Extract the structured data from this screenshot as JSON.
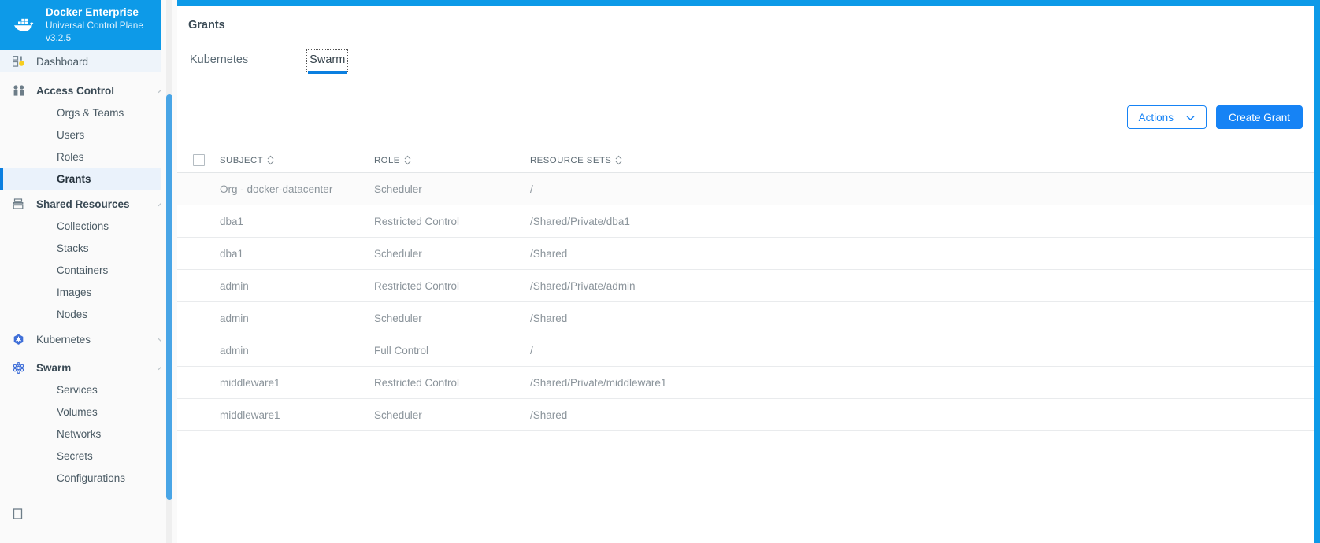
{
  "brand": {
    "logo_icon": "docker-whale-icon",
    "title": "Docker Enterprise",
    "subtitle": "Universal Control Plane v3.2.5",
    "bg_color": "#0d9ae8"
  },
  "sidebar": {
    "dashboard": {
      "label": "Dashboard",
      "icon": "dashboard-icon"
    },
    "groups": [
      {
        "label": "Access Control",
        "icon": "users-icon",
        "expanded": true,
        "chevron": "chevron-up-icon",
        "items": [
          {
            "label": "Orgs & Teams",
            "active": false
          },
          {
            "label": "Users",
            "active": false
          },
          {
            "label": "Roles",
            "active": false
          },
          {
            "label": "Grants",
            "active": true
          }
        ]
      },
      {
        "label": "Shared Resources",
        "icon": "layers-icon",
        "expanded": true,
        "chevron": "chevron-up-icon",
        "items": [
          {
            "label": "Collections",
            "active": false
          },
          {
            "label": "Stacks",
            "active": false
          },
          {
            "label": "Containers",
            "active": false
          },
          {
            "label": "Images",
            "active": false
          },
          {
            "label": "Nodes",
            "active": false
          }
        ]
      },
      {
        "label": "Kubernetes",
        "icon": "kubernetes-icon",
        "expanded": false,
        "chevron": "chevron-down-icon",
        "items": []
      },
      {
        "label": "Swarm",
        "icon": "swarm-icon",
        "expanded": true,
        "chevron": "chevron-up-icon",
        "items": [
          {
            "label": "Services",
            "active": false
          },
          {
            "label": "Volumes",
            "active": false
          },
          {
            "label": "Networks",
            "active": false
          },
          {
            "label": "Secrets",
            "active": false
          },
          {
            "label": "Configurations",
            "active": false
          }
        ]
      }
    ],
    "scrollbar": {
      "thumb_color": "#49a5e6",
      "track_color": "#efefef"
    }
  },
  "main": {
    "page_title": "Grants",
    "tabs": [
      {
        "label": "Kubernetes",
        "active": false
      },
      {
        "label": "Swarm",
        "active": true
      }
    ],
    "toolbar": {
      "actions_label": "Actions",
      "actions_chevron": "chevron-down-icon",
      "create_label": "Create Grant",
      "primary_color": "#1683f5"
    },
    "table": {
      "select_all_checkbox": false,
      "columns": [
        {
          "label": "SUBJECT",
          "sortable": true
        },
        {
          "label": "ROLE",
          "sortable": true
        },
        {
          "label": "RESOURCE SETS",
          "sortable": true
        }
      ],
      "rows": [
        {
          "subject": "Org - docker-datacenter",
          "role": "Scheduler",
          "resource_sets": "/"
        },
        {
          "subject": "dba1",
          "role": "Restricted Control",
          "resource_sets": "/Shared/Private/dba1"
        },
        {
          "subject": "dba1",
          "role": "Scheduler",
          "resource_sets": "/Shared"
        },
        {
          "subject": "admin",
          "role": "Restricted Control",
          "resource_sets": "/Shared/Private/admin"
        },
        {
          "subject": "admin",
          "role": "Scheduler",
          "resource_sets": "/Shared"
        },
        {
          "subject": "admin",
          "role": "Full Control",
          "resource_sets": "/"
        },
        {
          "subject": "middleware1",
          "role": "Restricted Control",
          "resource_sets": "/Shared/Private/middleware1"
        },
        {
          "subject": "middleware1",
          "role": "Scheduler",
          "resource_sets": "/Shared"
        }
      ]
    }
  }
}
